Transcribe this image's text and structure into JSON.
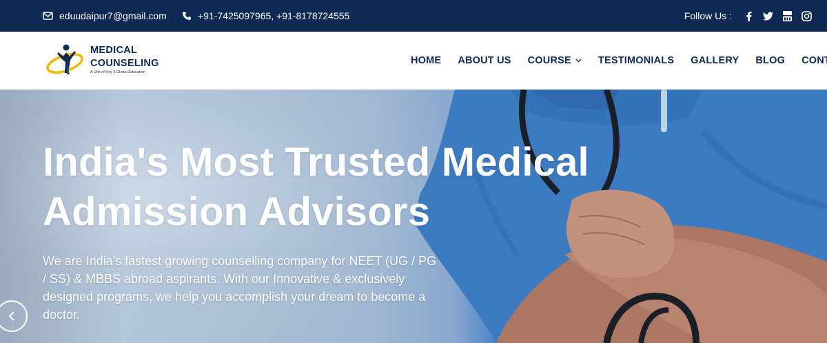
{
  "topbar": {
    "email": "eduudaipur7@gmail.com",
    "phone": "+91-7425097965, +91-8178724555",
    "follow_label": "Follow Us :",
    "socials": [
      "facebook-icon",
      "twitter-icon",
      "youtube-icon",
      "instagram-icon"
    ]
  },
  "logo": {
    "line1": "MEDICAL",
    "line2": "COUNSELING",
    "tagline": "A Unit of Key 2 Global Education"
  },
  "nav": {
    "items": [
      {
        "label": "HOME"
      },
      {
        "label": "ABOUT US"
      },
      {
        "label": "COURSE",
        "has_dropdown": true
      },
      {
        "label": "TESTIMONIALS"
      },
      {
        "label": "GALLERY"
      },
      {
        "label": "BLOG"
      },
      {
        "label": "CONTACT"
      }
    ]
  },
  "hero": {
    "title_line1": "India's Most Trusted Medical",
    "title_line2": "Admission Advisors",
    "description": "We are India's fastest growing counselling company for NEET (UG / PG / SS) & MBBS abroad aspirants. With our Innovative & exclusively designed programs, we help you accomplish your dream to become a doctor."
  },
  "colors": {
    "navy": "#0e2a52",
    "accent_yellow": "#f2b705",
    "scrub_blue": "#3d7fc8"
  }
}
